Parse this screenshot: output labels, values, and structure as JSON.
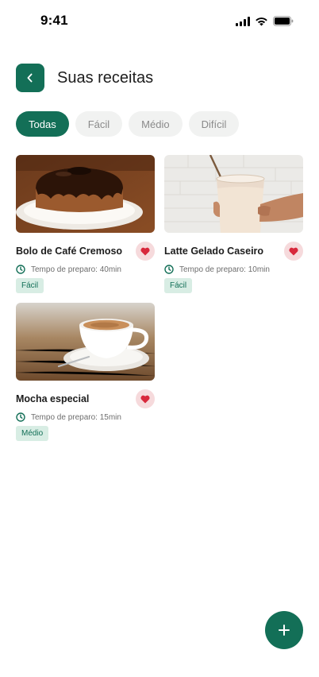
{
  "status_bar": {
    "time": "9:41"
  },
  "header": {
    "title": "Suas receitas"
  },
  "filters": [
    {
      "label": "Todas",
      "active": true
    },
    {
      "label": "Fácil",
      "active": false
    },
    {
      "label": "Médio",
      "active": false
    },
    {
      "label": "Difícil",
      "active": false
    }
  ],
  "recipes": [
    {
      "title": "Bolo de Café Cremoso",
      "prep": "Tempo de preparo: 40min",
      "difficulty": "Fácil",
      "favorite": true,
      "image": "chocolate-bundt-cake"
    },
    {
      "title": "Latte Gelado Caseiro",
      "prep": "Tempo de preparo: 10min",
      "difficulty": "Fácil",
      "favorite": true,
      "image": "iced-latte-glass"
    },
    {
      "title": "Mocha especial",
      "prep": "Tempo de preparo: 15min",
      "difficulty": "Médio",
      "favorite": true,
      "image": "cappuccino-cup"
    }
  ],
  "icons": {
    "back": "chevron-left-icon",
    "favorite": "heart-icon",
    "prep": "clock-icon",
    "add": "plus-icon"
  },
  "colors": {
    "primary": "#136f57",
    "chip_inactive_bg": "#f1f2f1",
    "badge_bg": "#d8ede4",
    "favorite_bg": "#f6dadc",
    "favorite_heart": "#d8283c"
  }
}
